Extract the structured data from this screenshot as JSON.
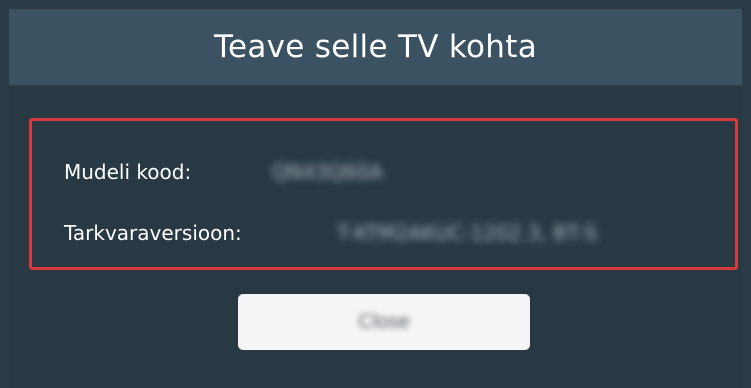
{
  "dialog": {
    "title": "Teave selle TV kohta",
    "rows": [
      {
        "label": "Mudeli kood:",
        "value": "QN43Q60A"
      },
      {
        "label": "Tarkvaraversioon:",
        "value": "T-KTM2AKUC-1202.3, BT-S"
      }
    ],
    "close_label": "Close"
  },
  "colors": {
    "background": "#2a3a47",
    "title_bar": "#3b5262",
    "highlight_border": "#d63a3f",
    "button": "#f4f5f6"
  }
}
